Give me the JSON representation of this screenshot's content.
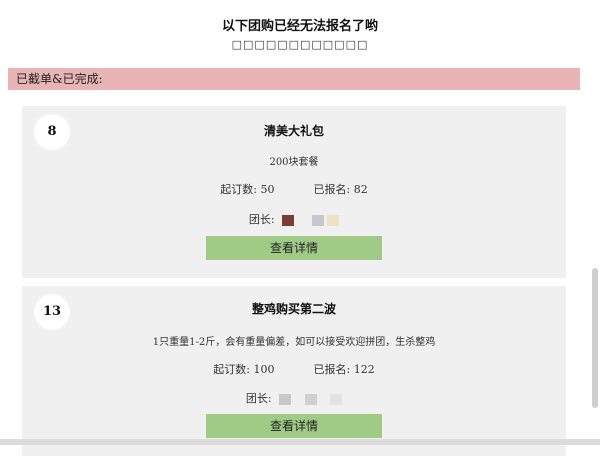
{
  "header": {
    "title": "以下团购已经无法报名了哟",
    "subtitle": "□□□□□□□□□□□□"
  },
  "status_bar": {
    "label": "已截单&已完成:"
  },
  "cards": [
    {
      "number": "8",
      "title": "清美大礼包",
      "description": "200块套餐",
      "min_label": "起订数:",
      "min_value": "50",
      "signed_label": "已报名:",
      "signed_value": "82",
      "leader_label": "团长:",
      "avatars": [
        "#7a3b30",
        "#c6c6cc",
        "#ece3c3"
      ],
      "button_label": "查看详情"
    },
    {
      "number": "13",
      "title": "整鸡购买第二波",
      "description": "1只重量1-2斤，会有重量偏差，如可以接受欢迎拼团，生杀整鸡",
      "min_label": "起订数:",
      "min_value": "100",
      "signed_label": "已报名:",
      "signed_value": "122",
      "leader_label": "团长:",
      "avatars": [
        "#c8c8c8",
        "#d0d0d0",
        "#e2e2e2"
      ],
      "button_label": "查看详情"
    }
  ],
  "colors": {
    "status_bar_bg": "#e8b4b6",
    "card_bg": "#f0f0f0",
    "button_bg": "#9fcb87"
  }
}
